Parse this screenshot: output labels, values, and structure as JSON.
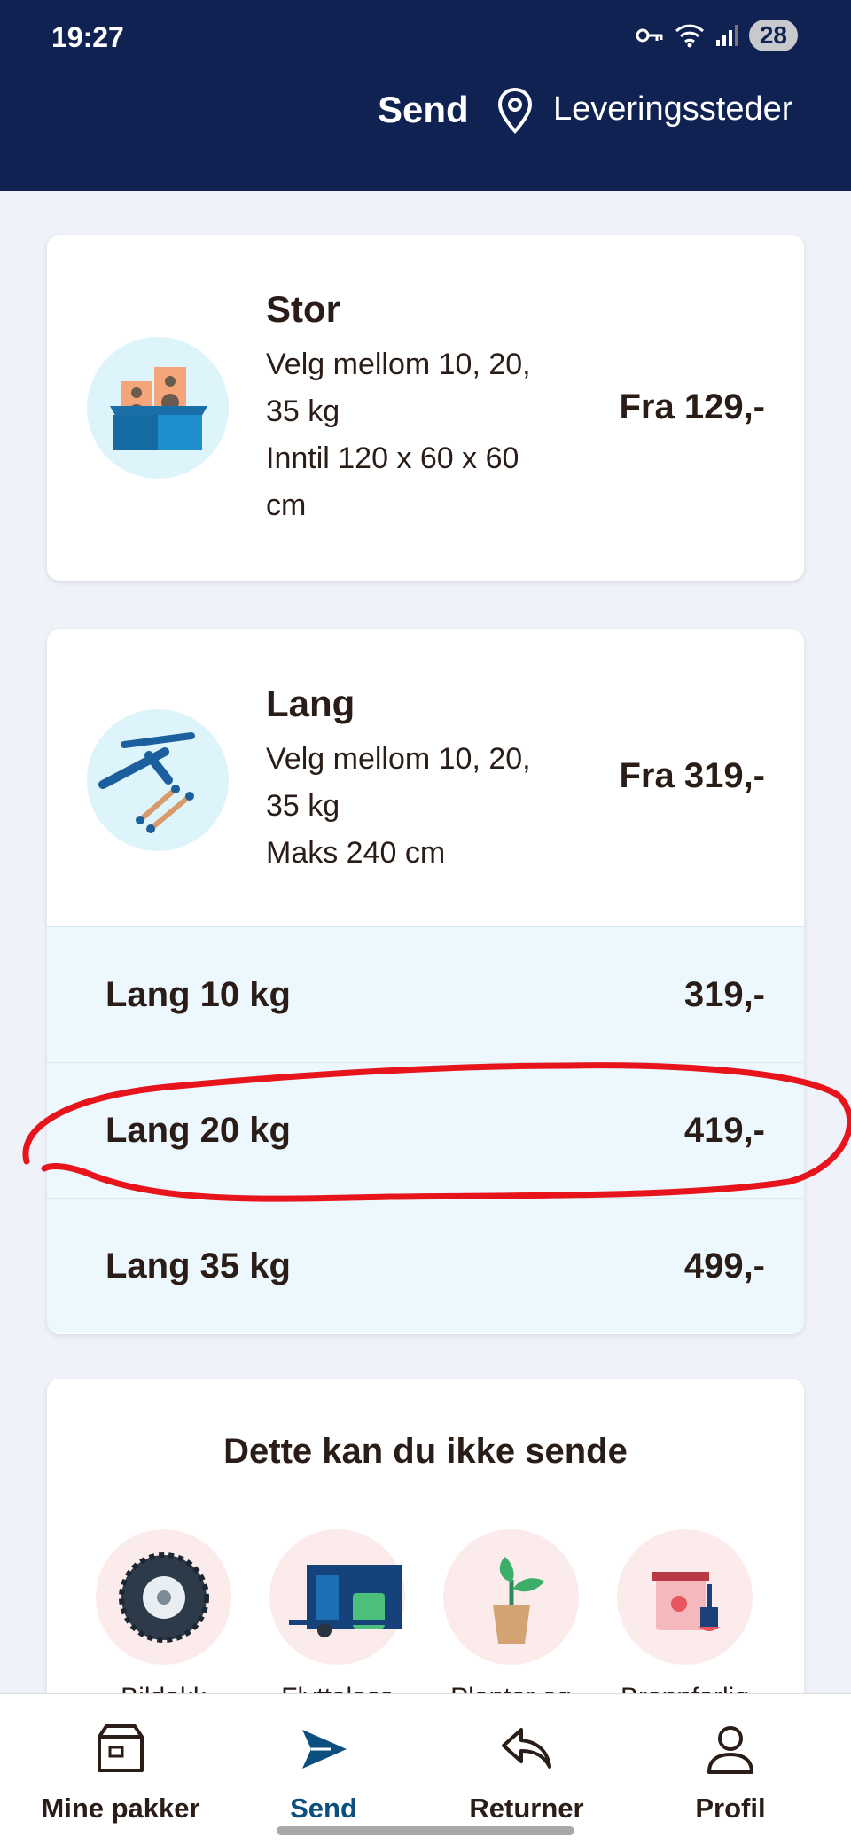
{
  "status_bar": {
    "time": "19:27",
    "battery": "28"
  },
  "header": {
    "send_label": "Send",
    "locations_label": "Leveringssteder"
  },
  "cards": [
    {
      "title": "Stor",
      "desc_line1": "Velg mellom 10, 20,",
      "desc_line2": "35 kg",
      "desc_line3": "Inntil 120 x 60 x 60",
      "desc_line4": "cm",
      "price": "Fra 129,-",
      "icon": "speakers-in-box-icon"
    },
    {
      "title": "Lang",
      "desc_line1": "Velg mellom 10, 20,",
      "desc_line2": "35 kg",
      "desc_line3": "Maks 240 cm",
      "price": "Fra 319,-",
      "icon": "garden-tools-icon",
      "options": [
        {
          "label": "Lang 10 kg",
          "price": "319,-"
        },
        {
          "label": "Lang 20 kg",
          "price": "419,-"
        },
        {
          "label": "Lang 35 kg",
          "price": "499,-"
        }
      ]
    }
  ],
  "restricted": {
    "title": "Dette kan du ikke sende",
    "items": [
      {
        "label": "Bildekk",
        "icon": "tire-icon"
      },
      {
        "label": "Flyttelass",
        "icon": "moving-van-icon"
      },
      {
        "label": "Planter og",
        "icon": "plant-icon"
      },
      {
        "label": "Brannfarlig",
        "icon": "paint-can-icon"
      }
    ]
  },
  "bottom_nav": [
    {
      "label": "Mine pakker",
      "icon": "package-icon"
    },
    {
      "label": "Send",
      "icon": "send-icon"
    },
    {
      "label": "Returner",
      "icon": "return-icon"
    },
    {
      "label": "Profil",
      "icon": "profile-icon"
    }
  ],
  "colors": {
    "header": "#0f2251",
    "accent": "#0a4f7e",
    "highlight": "#e8141b"
  }
}
